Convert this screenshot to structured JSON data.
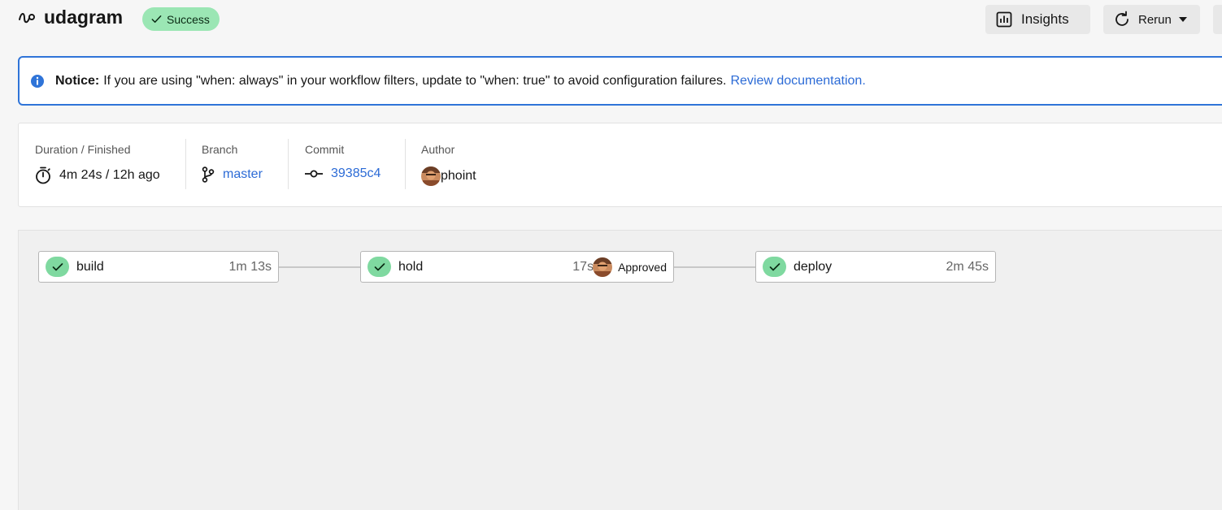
{
  "header": {
    "title": "udagram",
    "status": "Success",
    "insights_label": "Insights",
    "rerun_label": "Rerun"
  },
  "notice": {
    "label": "Notice:",
    "message": "If you are using \"when: always\" in your workflow filters, update to \"when: true\" to avoid configuration failures.",
    "link": "Review documentation."
  },
  "meta": {
    "duration_label": "Duration / Finished",
    "duration_value": "4m 24s / 12h ago",
    "branch_label": "Branch",
    "branch_value": "master",
    "commit_label": "Commit",
    "commit_value": "39385c4",
    "author_label": "Author",
    "author_value": "phoint"
  },
  "jobs": [
    {
      "name": "build",
      "duration": "1m 13s",
      "status": "success"
    },
    {
      "name": "hold",
      "duration": "17s",
      "approval": "Approved",
      "status": "success"
    },
    {
      "name": "deploy",
      "duration": "2m 45s",
      "status": "success"
    }
  ],
  "colors": {
    "success_green": "#9be6b4",
    "link_blue": "#2c6bd6",
    "notice_border": "#2f74d8"
  }
}
